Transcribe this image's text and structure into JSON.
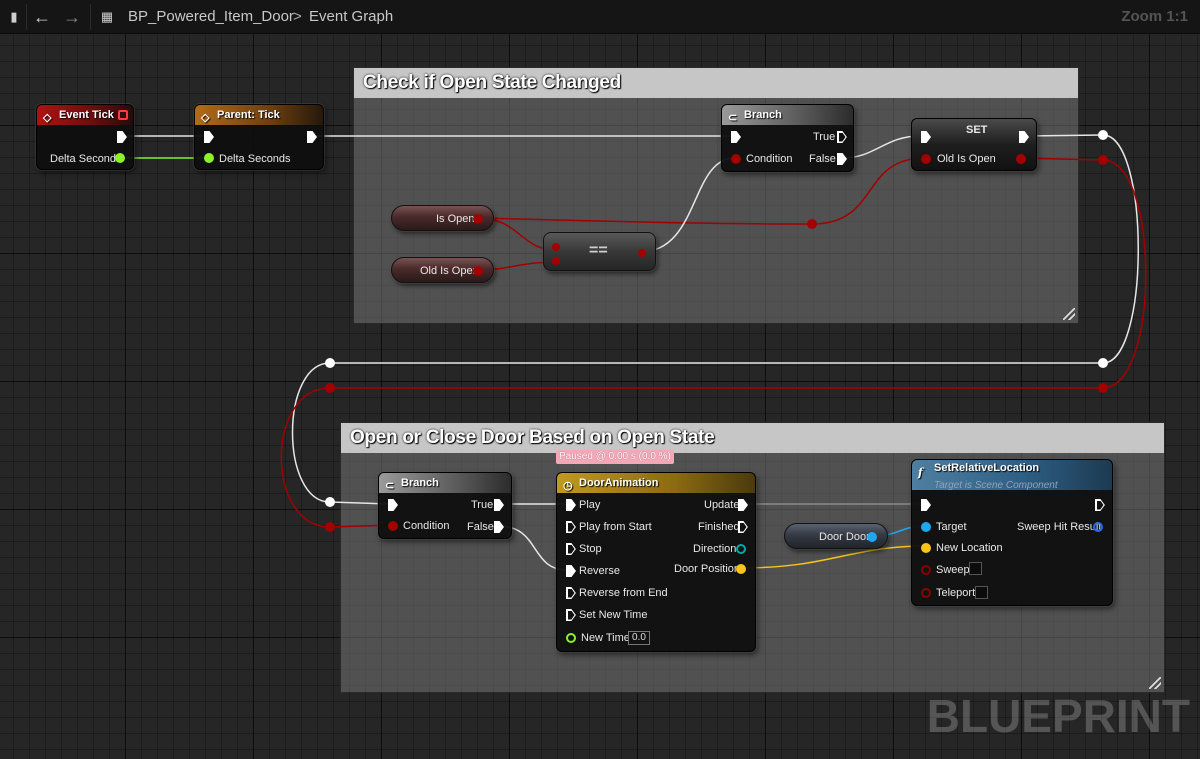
{
  "topbar": {
    "breadcrumb_blueprint": "BP_Powered_Item_Door",
    "breadcrumb_separator": ">",
    "breadcrumb_graph": "Event Graph",
    "zoom": "Zoom 1:1"
  },
  "comments": {
    "check_title": "Check if Open State Changed",
    "door_title": "Open or Close Door Based on Open State"
  },
  "event_tick": {
    "title": "Event Tick",
    "pin_delta": "Delta Seconds"
  },
  "parent_tick": {
    "title": "Parent: Tick",
    "pin_delta": "Delta Seconds"
  },
  "branch1": {
    "title": "Branch",
    "pin_condition": "Condition",
    "pin_true": "True",
    "pin_false": "False"
  },
  "set_node": {
    "title": "SET",
    "pin_old_is_open": "Old Is Open"
  },
  "var_is_open": {
    "label": "Is Open"
  },
  "var_old_is_open": {
    "label": "Old Is Open"
  },
  "compare": {
    "label": "=="
  },
  "branch2": {
    "title": "Branch",
    "pin_condition": "Condition",
    "pin_true": "True",
    "pin_false": "False"
  },
  "timeline": {
    "title": "DoorAnimation",
    "status": "Paused @ 0.00 s (0.0 %)",
    "inputs": [
      "Play",
      "Play from Start",
      "Stop",
      "Reverse",
      "Reverse from End",
      "Set New Time"
    ],
    "new_time_label": "New Time",
    "new_time_value": "0.0",
    "outputs": {
      "update": "Update",
      "finished": "Finished",
      "direction": "Direction",
      "door_position": "Door Position"
    }
  },
  "var_door": {
    "label": "Door Door"
  },
  "set_rel_loc": {
    "title": "SetRelativeLocation",
    "subtitle": "Target is Scene Component",
    "pin_target": "Target",
    "pin_new_location": "New Location",
    "pin_sweep": "Sweep",
    "pin_teleport": "Teleport",
    "pin_sweep_hit": "Sweep Hit Result"
  },
  "watermark": "BLUEPRINT",
  "colors": {
    "exec": "#ffffff",
    "bool": "#a30000",
    "float": "#8cf02a",
    "vector": "#f8c31b",
    "object": "#1fa7f0"
  }
}
